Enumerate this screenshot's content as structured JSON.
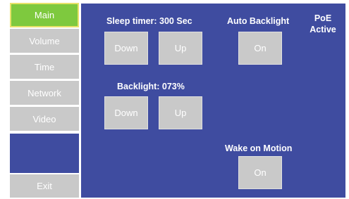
{
  "sidebar": {
    "items": [
      {
        "label": "Main",
        "active": true
      },
      {
        "label": "Volume"
      },
      {
        "label": "Time"
      },
      {
        "label": "Network"
      },
      {
        "label": "Video"
      }
    ],
    "exit_label": "Exit"
  },
  "main": {
    "sleep_timer": {
      "label": "Sleep timer: 300 Sec",
      "down": "Down",
      "up": "Up"
    },
    "backlight": {
      "label": "Backlight: 073%",
      "down": "Down",
      "up": "Up"
    },
    "auto_backlight": {
      "label": "Auto Backlight",
      "button": "On"
    },
    "wake_on_motion": {
      "label": "Wake on Motion",
      "button": "On"
    },
    "poe_status": {
      "line1": "PoE",
      "line2": "Active"
    }
  },
  "colors": {
    "panel": "#3f4ca0",
    "button": "#c9c9c9",
    "active_tab": "#7ec93e",
    "active_border": "#e8e26a"
  }
}
